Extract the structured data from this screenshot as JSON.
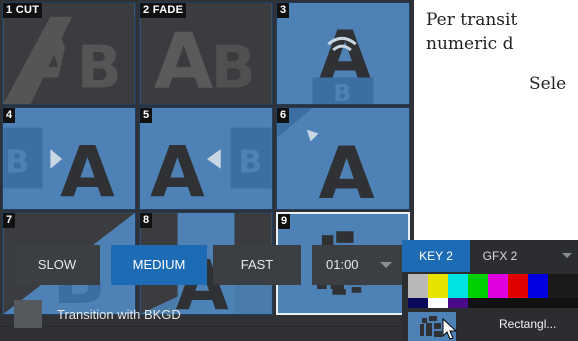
{
  "transitions": [
    {
      "num": "1",
      "label": "CUT"
    },
    {
      "num": "2",
      "label": "FADE"
    },
    {
      "num": "3",
      "label": ""
    },
    {
      "num": "4",
      "label": ""
    },
    {
      "num": "5",
      "label": ""
    },
    {
      "num": "6",
      "label": ""
    },
    {
      "num": "7",
      "label": ""
    },
    {
      "num": "8",
      "label": ""
    },
    {
      "num": "9",
      "label": ""
    }
  ],
  "selected_transition": "9",
  "speed": {
    "slow": "SLOW",
    "medium": "MEDIUM",
    "fast": "FAST",
    "active": "MEDIUM",
    "duration": "01:00"
  },
  "bkgd": {
    "label": "Transition with BKGD",
    "checked": false
  },
  "doc": {
    "line1": "Per transit",
    "line2": "numeric d",
    "line3": "Sele"
  },
  "right_panel": {
    "tabs": [
      "KEY 2",
      "GFX 2"
    ],
    "active_tab": "KEY 2",
    "item_label": "Rectangl..."
  },
  "colors": {
    "accent": "#1d6bb5",
    "tile": "#4e82b6",
    "panel": "#2f3134"
  }
}
